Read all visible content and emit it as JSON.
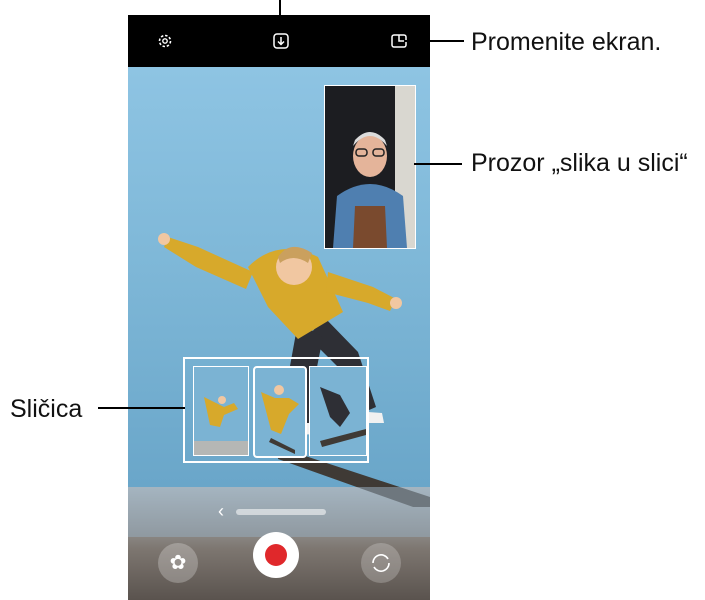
{
  "callouts": {
    "change_screen": "Promenite ekran.",
    "pip_window": "Prozor „slika u slici“",
    "thumbnail": "Sličica"
  },
  "top_bar": {
    "settings_icon": "gear-icon",
    "save_icon": "download-icon",
    "layout_icon": "screen-layout-icon"
  },
  "controls": {
    "effects_icon": "flower-icon",
    "record_button": "record-icon",
    "flip_icon": "switch-camera-icon"
  },
  "colors": {
    "record": "#e0282b",
    "top_bar": "#000000",
    "callout_line": "#000000"
  }
}
